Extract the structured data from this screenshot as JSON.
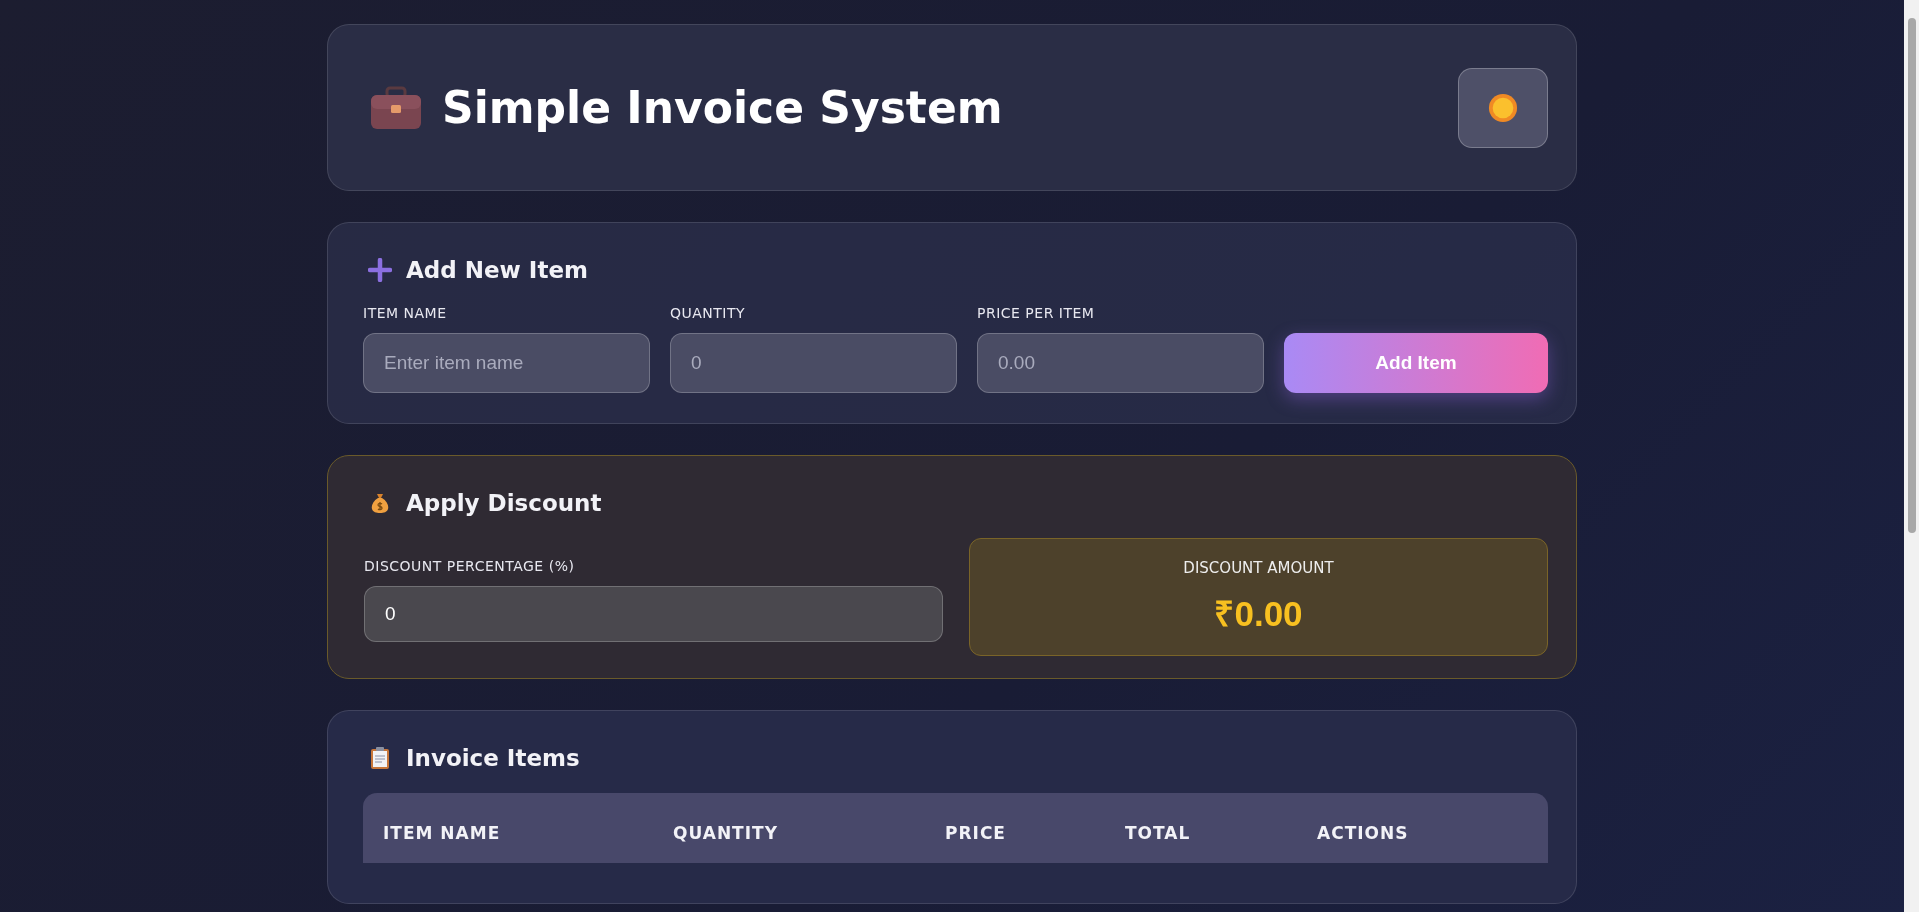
{
  "header": {
    "title": "Simple Invoice System"
  },
  "add_item": {
    "heading": "Add New Item",
    "fields": [
      {
        "label": "ITEM NAME",
        "placeholder": "Enter item name"
      },
      {
        "label": "QUANTITY",
        "placeholder": "0"
      },
      {
        "label": "PRICE PER ITEM",
        "placeholder": "0.00"
      }
    ],
    "button": "Add Item"
  },
  "discount": {
    "heading": "Apply Discount",
    "label": "DISCOUNT PERCENTAGE (%)",
    "value": "0",
    "amount_label": "DISCOUNT AMOUNT",
    "amount": "₹0.00"
  },
  "invoice_items": {
    "heading": "Invoice Items",
    "columns": [
      "ITEM NAME",
      "QUANTITY",
      "PRICE",
      "TOTAL",
      "ACTIONS"
    ]
  }
}
